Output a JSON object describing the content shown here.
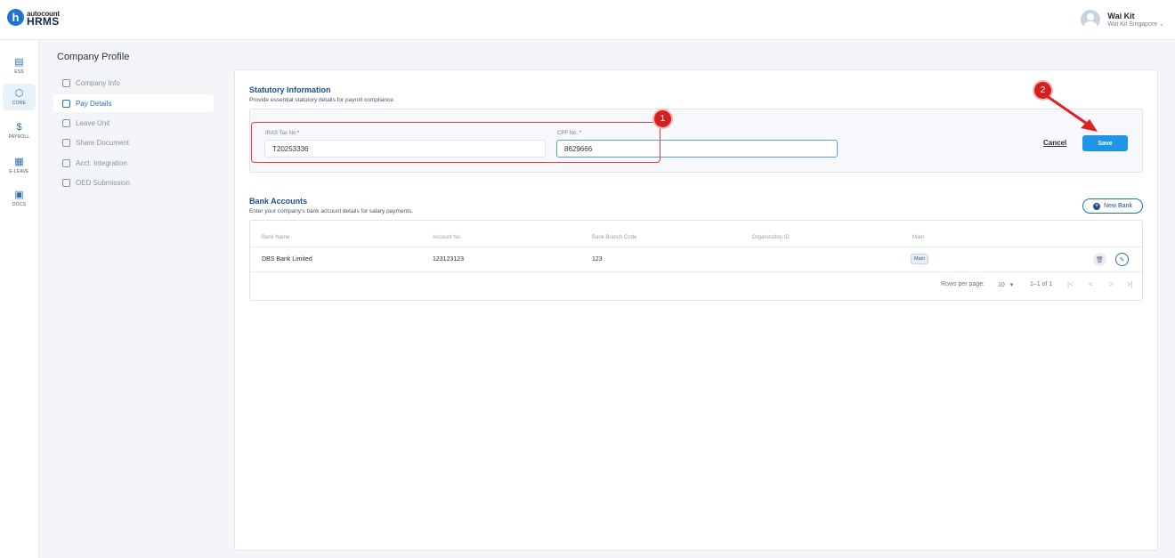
{
  "app": {
    "logo_letter": "h",
    "logo_top": "autocount",
    "logo_bottom": "HRMS",
    "user_name": "Wai Kit",
    "user_org": "Wai Kit Singapore ⌄"
  },
  "rail": [
    {
      "label": "ESS",
      "icon": "ess-icon"
    },
    {
      "label": "CORE",
      "icon": "core-icon"
    },
    {
      "label": "PAYROLL",
      "icon": "payroll-icon"
    },
    {
      "label": "E-LEAVE",
      "icon": "calendar-icon"
    },
    {
      "label": "DOCS",
      "icon": "docs-icon"
    }
  ],
  "subnav": {
    "title": "Company Profile",
    "items": [
      {
        "label": "Company Info",
        "active": false
      },
      {
        "label": "Pay Details",
        "active": true
      },
      {
        "label": "Leave Unit",
        "active": false
      },
      {
        "label": "Share Document",
        "active": false
      },
      {
        "label": "Acct. Integration",
        "active": false
      },
      {
        "label": "OED Submission",
        "active": false
      }
    ]
  },
  "statutory": {
    "title": "Statutory Information",
    "subtitle": "Provide essential statutory details for payroll compliance.",
    "iras_label": "IRAS Tax No",
    "iras_value": "T20253336",
    "cpf_label": "CPF No.",
    "cpf_value": "8629666",
    "required_mark": "*",
    "cancel_label": "Cancel",
    "save_label": "Save"
  },
  "annotations": {
    "badge1": "1",
    "badge2": "2"
  },
  "bank": {
    "title": "Bank Accounts",
    "subtitle": "Enter your company's bank account details for salary payments.",
    "new_bank_label": "New Bank",
    "columns": [
      "Bank Name",
      "Account No.",
      "Bank Branch Code",
      "Organization ID",
      "Main"
    ],
    "rows": [
      {
        "bank_name": "DBS Bank Limited",
        "account_no": "123123123",
        "branch_code": "123",
        "org_id": "",
        "main": "Main"
      }
    ],
    "rows_per_page_label": "Rows per page:",
    "rows_per_page_value": "10",
    "range": "1–1 of 1"
  },
  "colors": {
    "accent": "#1e95e6",
    "brand": "#1f74c9",
    "annotation_red": "#d32020"
  }
}
